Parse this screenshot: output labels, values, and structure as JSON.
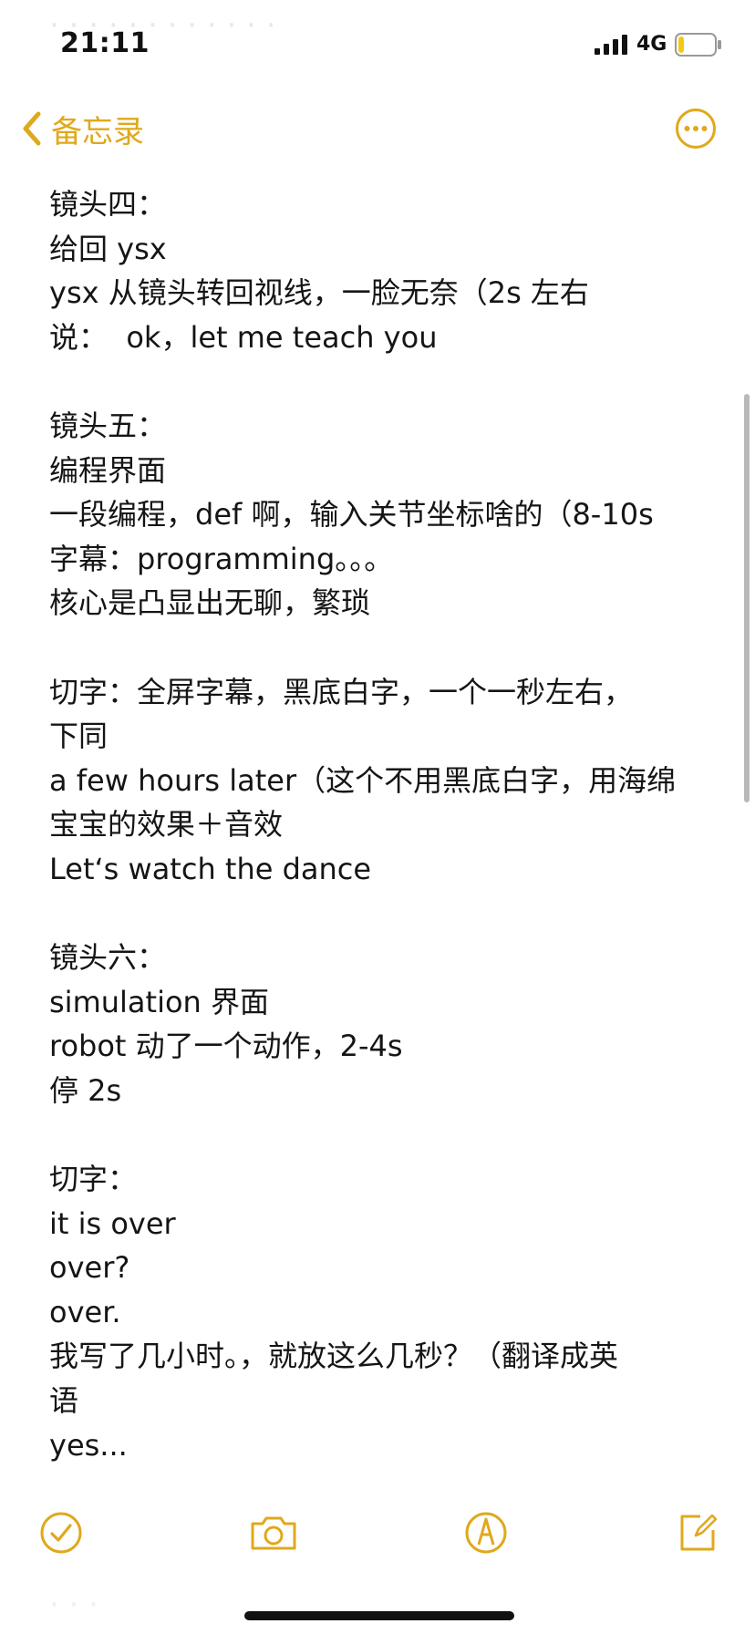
{
  "status_bar": {
    "time": "21:11",
    "network": "4G",
    "battery_level": 0.15
  },
  "nav": {
    "back_label": "备忘录",
    "back_icon": "chevron-left-icon",
    "more_icon": "ellipsis-circle-icon"
  },
  "note": {
    "lines": [
      "镜头四：",
      "给回 ysx",
      "ysx 从镜头转回视线，一脸无奈（2s 左右",
      "说：  ok，let me teach you",
      "",
      "镜头五：",
      "编程界面",
      "一段编程，def 啊，输入关节坐标啥的（8-10s",
      "字幕：programming。。。",
      "核心是凸显出无聊，繁琐",
      "",
      "切字：全屏字幕，黑底白字，一个一秒左右，",
      "下同",
      "a few hours later（这个不用黑底白字，用海绵",
      "宝宝的效果＋音效",
      "Let‘s watch the dance",
      "",
      "镜头六：",
      "simulation 界面",
      "robot 动了一个动作，2-4s",
      "停 2s",
      "",
      "切字：",
      "it is over",
      "over?",
      "over.",
      "我写了几小时。，就放这么几秒？（翻译成英",
      "语",
      "yes..."
    ]
  },
  "toolbar": {
    "checklist_icon": "checklist-icon",
    "camera_icon": "camera-icon",
    "markup_icon": "markup-pen-icon",
    "compose_icon": "compose-icon"
  },
  "colors": {
    "accent": "#e0a81c",
    "text": "#151515",
    "background": "#ffffff"
  }
}
